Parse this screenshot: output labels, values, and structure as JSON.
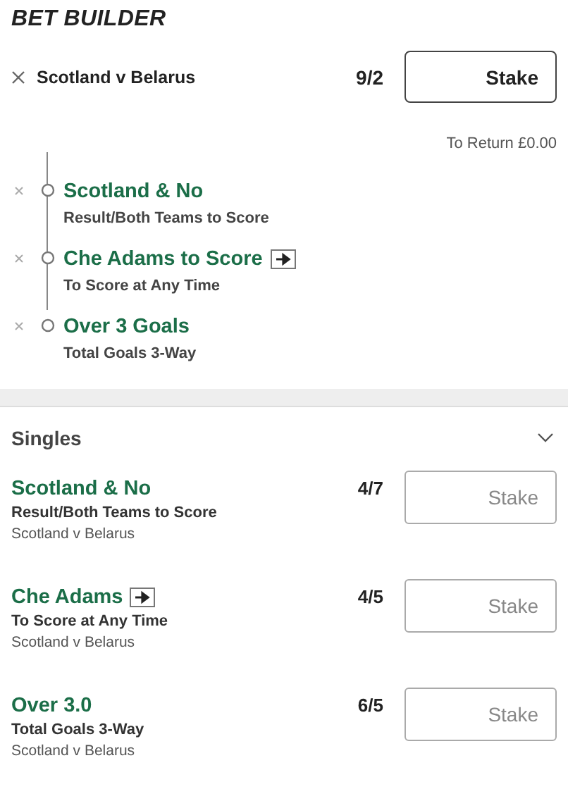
{
  "title": "BET BUILDER",
  "builder": {
    "event": "Scotland v Belarus",
    "odds": "9/2",
    "stake": {
      "placeholder": "Stake"
    },
    "to_return": "To Return £0.00",
    "legs": [
      {
        "name": "Scotland & No",
        "market": "Result/Both Teams to Score",
        "has_icon": false
      },
      {
        "name": "Che Adams to Score",
        "market": "To Score at Any Time",
        "has_icon": true
      },
      {
        "name": "Over 3 Goals",
        "market": "Total Goals 3-Way",
        "has_icon": false
      }
    ]
  },
  "singles": {
    "title": "Singles",
    "expanded": true,
    "bets": [
      {
        "name": "Scotland & No",
        "market": "Result/Both Teams to Score",
        "event": "Scotland v Belarus",
        "odds": "4/7",
        "has_icon": false,
        "stake": {
          "placeholder": "Stake"
        }
      },
      {
        "name": "Che Adams",
        "market": "To Score at Any Time",
        "event": "Scotland v Belarus",
        "odds": "4/5",
        "has_icon": true,
        "stake": {
          "placeholder": "Stake"
        }
      },
      {
        "name": "Over 3.0",
        "market": "Total Goals 3-Way",
        "event": "Scotland v Belarus",
        "odds": "6/5",
        "has_icon": false,
        "stake": {
          "placeholder": "Stake"
        }
      }
    ]
  }
}
